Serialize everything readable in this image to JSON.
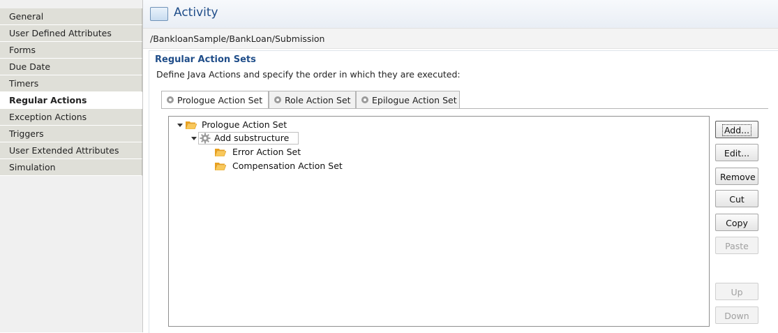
{
  "sidebar": {
    "items": [
      {
        "label": "General"
      },
      {
        "label": "User Defined Attributes"
      },
      {
        "label": "Forms"
      },
      {
        "label": "Due Date"
      },
      {
        "label": "Timers"
      },
      {
        "label": "Regular Actions",
        "active": true
      },
      {
        "label": "Exception Actions"
      },
      {
        "label": "Triggers"
      },
      {
        "label": "User Extended Attributes"
      },
      {
        "label": "Simulation"
      }
    ]
  },
  "header": {
    "title": "Activity",
    "icon": "activity-icon"
  },
  "path": "/BankloanSample/BankLoan/Submission",
  "section": {
    "title": "Regular Action Sets",
    "description": "Define Java Actions and specify the order in which they are executed:"
  },
  "tabs": [
    {
      "label": "Prologue Action Set",
      "active": true,
      "icon": "gear-icon"
    },
    {
      "label": "Role Action Set",
      "icon": "gear-icon"
    },
    {
      "label": "Epilogue Action Set",
      "icon": "gear-icon"
    }
  ],
  "tree": {
    "root": {
      "label": "Prologue Action Set",
      "icon": "folder-open-icon"
    },
    "child": {
      "label": "Add substructure",
      "icon": "gear-icon"
    },
    "grandchildren": [
      {
        "label": "Error Action Set",
        "icon": "folder-open-icon"
      },
      {
        "label": "Compensation Action Set",
        "icon": "folder-open-icon"
      }
    ]
  },
  "buttons": {
    "add": "Add...",
    "edit": "Edit...",
    "remove": "Remove",
    "cut": "Cut",
    "copy": "Copy",
    "paste": "Paste",
    "up": "Up",
    "down": "Down"
  },
  "colors": {
    "accent": "#1f4d89",
    "folder": "#f5b53a"
  }
}
